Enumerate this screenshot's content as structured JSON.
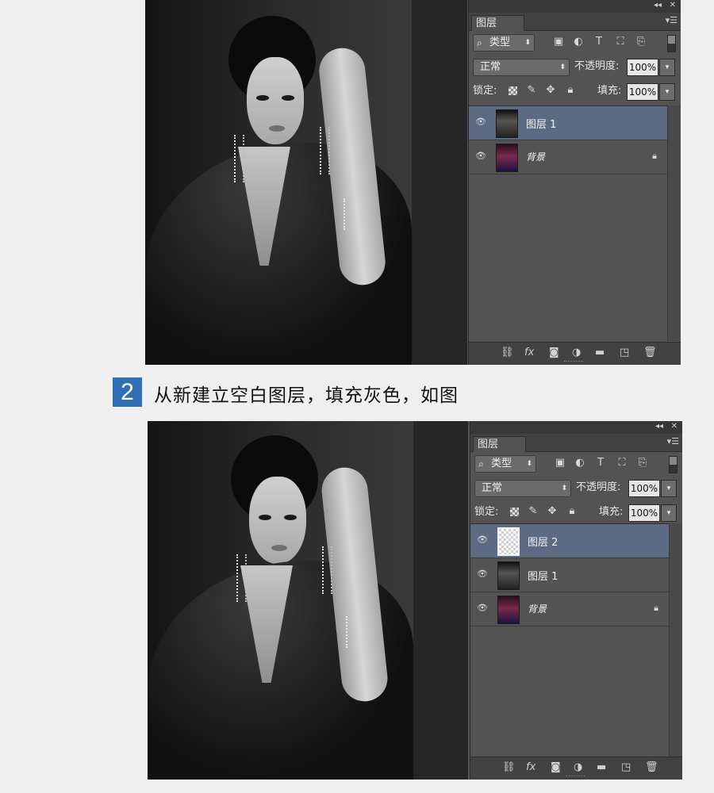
{
  "screens": [
    {
      "panel": {
        "tab": "图层",
        "filter_label": "类型",
        "blend_mode": "正常",
        "opacity_label": "不透明度:",
        "opacity_value": "100%",
        "lock_label": "锁定:",
        "fill_label": "填充:",
        "fill_value": "100%",
        "layers": [
          {
            "name": "图层 1",
            "thumb": "photo1",
            "selected": true,
            "locked": false,
            "italic": false
          },
          {
            "name": "背景",
            "thumb": "photo0",
            "selected": false,
            "locked": true,
            "italic": true
          }
        ]
      }
    },
    {
      "panel": {
        "tab": "图层",
        "filter_label": "类型",
        "blend_mode": "正常",
        "opacity_label": "不透明度:",
        "opacity_value": "100%",
        "lock_label": "锁定:",
        "fill_label": "填充:",
        "fill_value": "100%",
        "layers": [
          {
            "name": "图层 2",
            "thumb": "empty",
            "selected": true,
            "locked": false,
            "italic": false
          },
          {
            "name": "图层 1",
            "thumb": "photo1",
            "selected": false,
            "locked": false,
            "italic": false
          },
          {
            "name": "背景",
            "thumb": "photo0",
            "selected": false,
            "locked": true,
            "italic": true
          }
        ]
      }
    }
  ],
  "step": {
    "number": "2",
    "text": "从新建立空白图层，填充灰色，如图"
  },
  "colors": {
    "step_badge": "#2f6fb4",
    "panel_bg": "#535353",
    "selected_layer": "#5c6b83"
  },
  "icons": {
    "panel_top": [
      "collapse-icon",
      "close-icon",
      "panel-menu-icon"
    ],
    "filter": [
      "search-icon",
      "image-filter-icon",
      "adjustment-filter-icon",
      "type-filter-icon",
      "shape-filter-icon",
      "smart-object-filter-icon"
    ],
    "lock": [
      "lock-transparent-icon",
      "lock-brush-icon",
      "lock-move-icon",
      "lock-all-icon"
    ],
    "bottom": [
      "link-icon",
      "fx-icon",
      "mask-icon",
      "adjustment-icon",
      "group-icon",
      "new-layer-icon",
      "trash-icon"
    ]
  }
}
